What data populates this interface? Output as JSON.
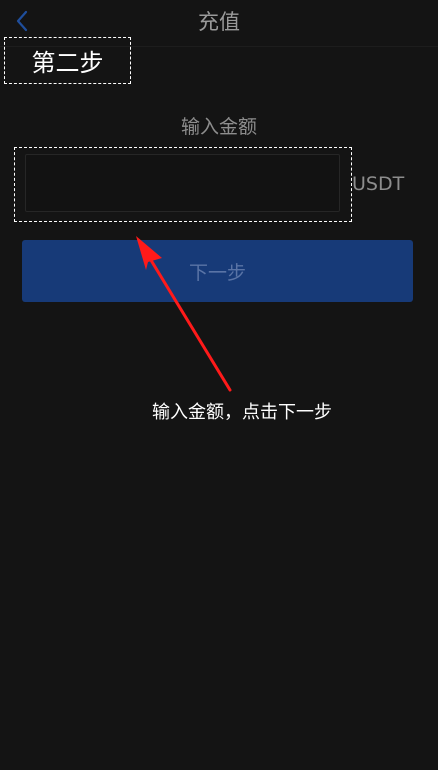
{
  "header": {
    "title": "充值",
    "back_icon": "chevron-left-icon",
    "back_icon_color": "#1f4e9c"
  },
  "annotation": {
    "step_label": "第二步",
    "instruction": "输入金额，点击下一步",
    "arrow_color": "#ff1a1a",
    "highlight_color": "#ffffff"
  },
  "form": {
    "amount_label": "输入金额",
    "amount_value": "",
    "amount_placeholder": "",
    "unit": "USDT",
    "next_button_label": "下一步",
    "button_color": "#173a78"
  }
}
